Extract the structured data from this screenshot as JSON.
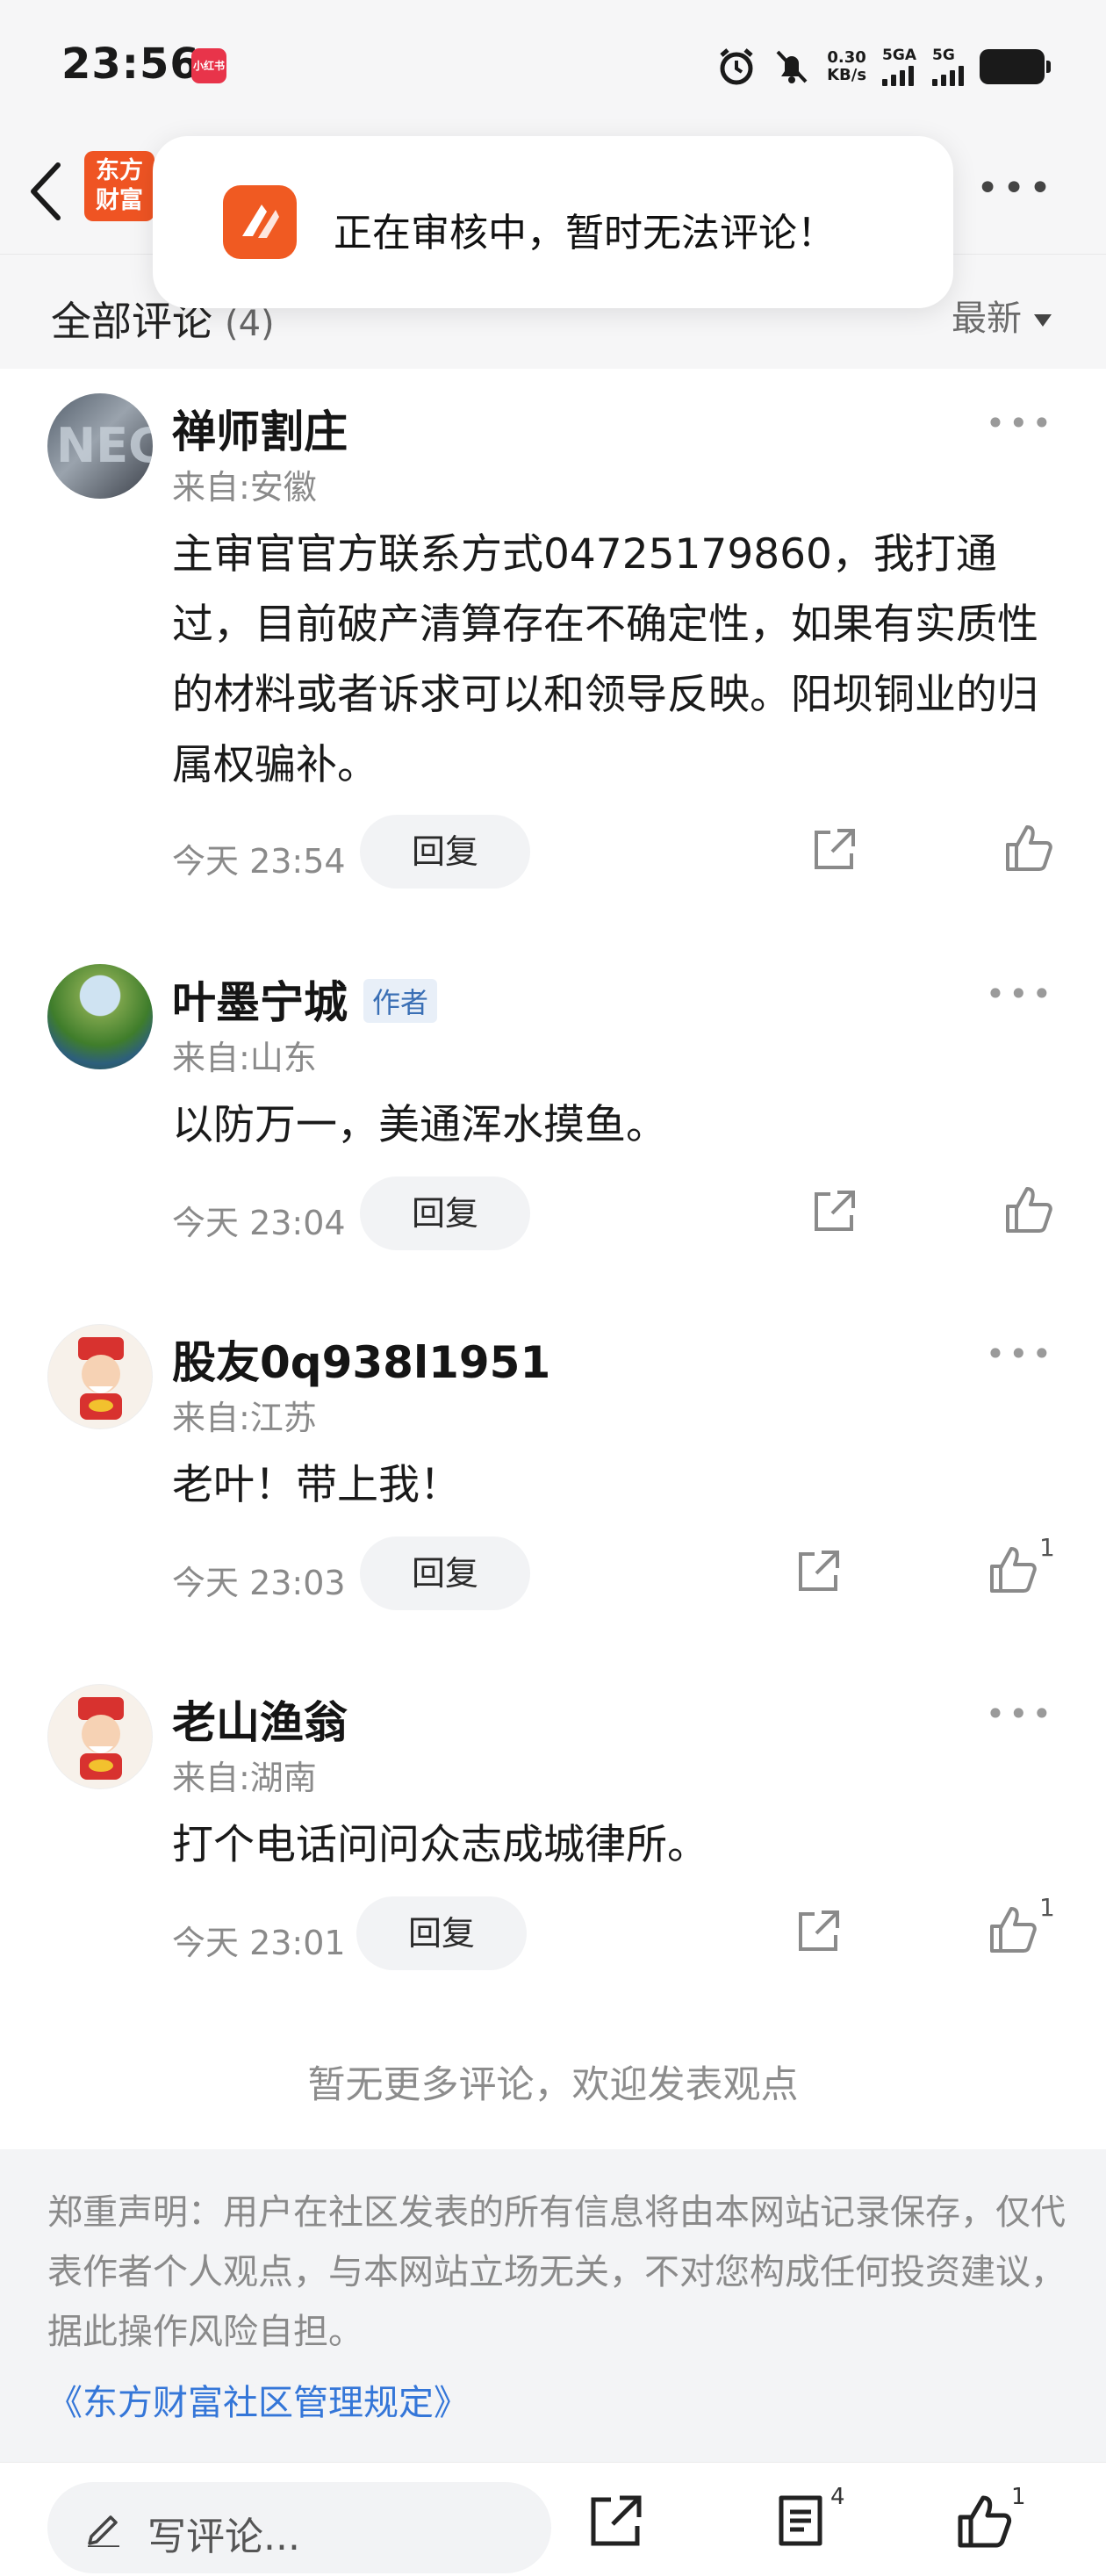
{
  "status_bar": {
    "time": "23:56",
    "app_badge": "小红书",
    "net_speed_value": "0.30",
    "net_speed_unit": "KB/s",
    "sim1": "5GA",
    "sim2": "5G"
  },
  "header": {
    "logo_line1": "东方",
    "logo_line2": "财富",
    "back_icon": "chevron-left-icon",
    "more_icon": "more-horizontal-icon"
  },
  "toast": {
    "icon": "eastmoney-app-icon",
    "message": "正在审核中，暂时无法评论！"
  },
  "section": {
    "title": "全部评论",
    "count": "(4)",
    "sort_label": "最新"
  },
  "comments": [
    {
      "username": "禅师割庄",
      "badge": "",
      "location": "来自:安徽",
      "text": "主审官官方联系方式04725179860，我打通过，目前破产清算存在不确定性，如果有实质性的材料或者诉求可以和领导反映。阳坝铜业的归属权骗补。",
      "time": "今天 23:54",
      "reply_label": "回复",
      "likes": ""
    },
    {
      "username": "叶墨宁城",
      "badge": "作者",
      "location": "来自:山东",
      "text": "以防万一，美通浑水摸鱼。",
      "time": "今天 23:04",
      "reply_label": "回复",
      "likes": ""
    },
    {
      "username": "股友0q938l1951",
      "badge": "",
      "location": "来自:江苏",
      "text": "老叶！带上我！",
      "time": "今天 23:03",
      "reply_label": "回复",
      "likes": "1"
    },
    {
      "username": "老山渔翁",
      "badge": "",
      "location": "来自:湖南",
      "text": "打个电话问问众志成城律所。",
      "time": "今天 23:01",
      "reply_label": "回复",
      "likes": "1"
    }
  ],
  "no_more": "暂无更多评论，欢迎发表观点",
  "disclaimer": {
    "text": "郑重声明：用户在社区发表的所有信息将由本网站记录保存，仅代表作者个人观点，与本网站立场无关，不对您构成任何投资建议，据此操作风险自担。",
    "link": "《东方财富社区管理规定》"
  },
  "bottom_bar": {
    "write_placeholder": "写评论...",
    "comment_count": "4",
    "like_count": "1"
  },
  "colors": {
    "brand_orange": "#ef5423",
    "link_blue": "#3476d8",
    "author_badge_blue": "#3a6fb5"
  }
}
